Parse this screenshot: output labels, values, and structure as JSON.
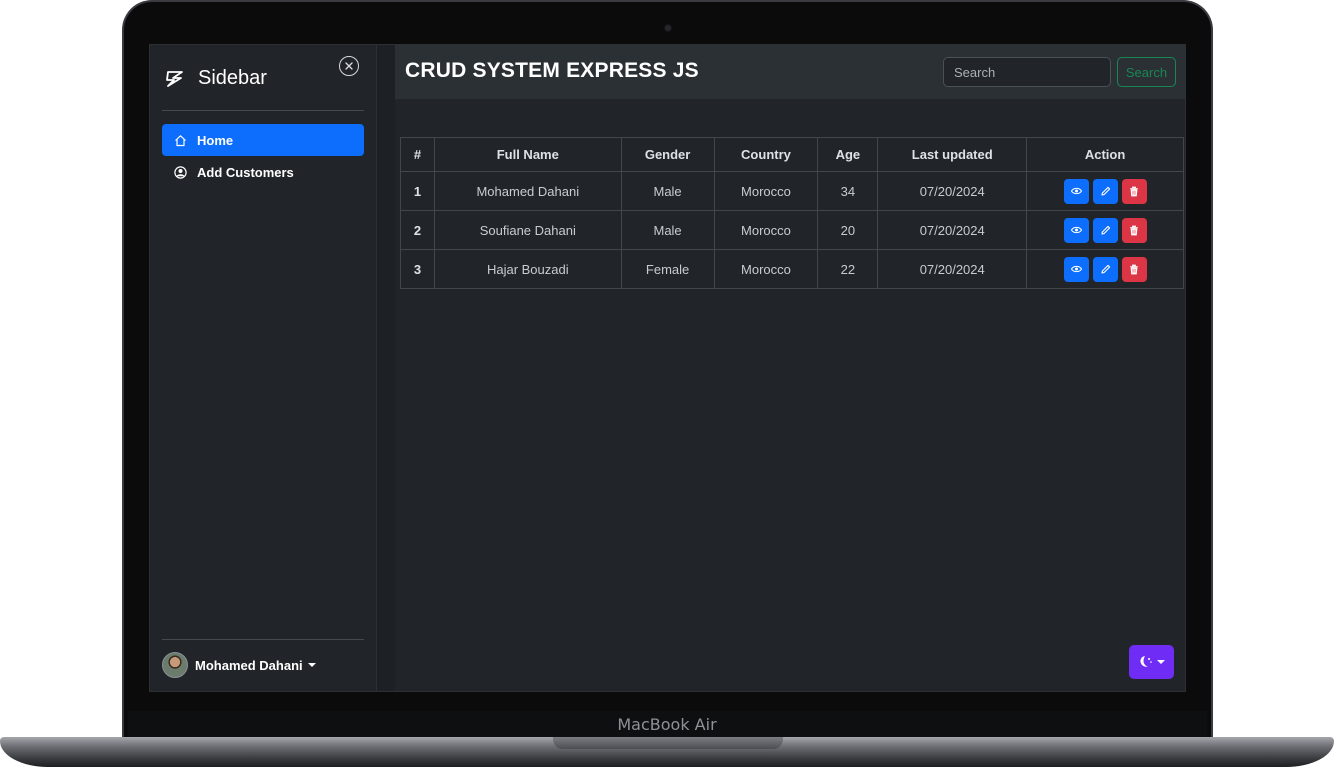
{
  "device": {
    "label": "MacBook Air"
  },
  "sidebar": {
    "brand": "Sidebar",
    "brand_icon": "lightning-icon",
    "items": [
      {
        "label": "Home",
        "icon": "house-icon",
        "active": true
      },
      {
        "label": "Add Customers",
        "icon": "person-circle-icon",
        "active": false
      }
    ],
    "user": {
      "name": "Mohamed Dahani"
    }
  },
  "header": {
    "title": "CRUD SYSTEM EXPRESS JS",
    "search_placeholder": "Search",
    "search_button": "Search"
  },
  "table": {
    "columns": [
      "#",
      "Full Name",
      "Gender",
      "Country",
      "Age",
      "Last updated",
      "Action"
    ],
    "rows": [
      {
        "index": "1",
        "name": "Mohamed Dahani",
        "gender": "Male",
        "country": "Morocco",
        "age": "34",
        "updated": "07/20/2024"
      },
      {
        "index": "2",
        "name": "Soufiane Dahani",
        "gender": "Male",
        "country": "Morocco",
        "age": "20",
        "updated": "07/20/2024"
      },
      {
        "index": "3",
        "name": "Hajar Bouzadi",
        "gender": "Female",
        "country": "Morocco",
        "age": "22",
        "updated": "07/20/2024"
      }
    ]
  },
  "colors": {
    "primary": "#0d6efd",
    "danger": "#dc3545",
    "success": "#198754",
    "theme_toggle": "#6f2cf5",
    "background": "#212529"
  }
}
